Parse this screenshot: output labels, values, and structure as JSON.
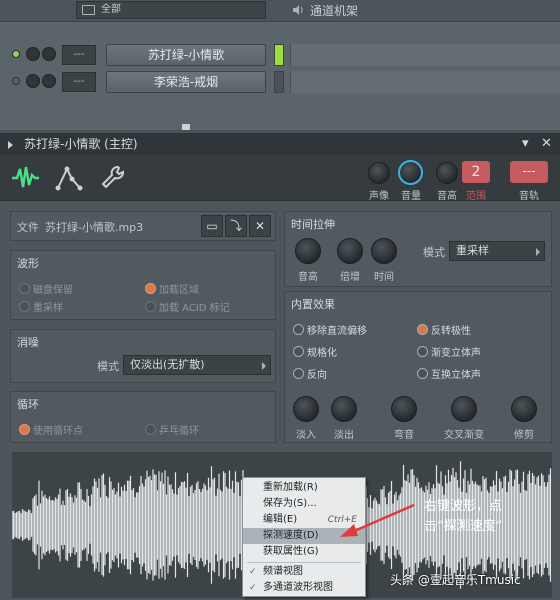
{
  "rack": {
    "filter_label": "全部",
    "title": "通道机架",
    "channels": [
      {
        "number": "---",
        "name": "苏打绿-小情歌"
      },
      {
        "number": "---",
        "name": "李荣浩-戒烟"
      }
    ]
  },
  "plugin": {
    "title": "苏打绿-小情歌 (主控)",
    "pin_label": "▾",
    "close_label": "✕",
    "knobs": {
      "pan_label": "声像",
      "volume_label": "音量",
      "pitch_label": "音高",
      "range_label": "范围",
      "range_value": "2",
      "mixer_label": "音轨",
      "mixer_value": "---"
    },
    "file": {
      "label": "文件",
      "value": "苏打绿-小情歌.mp3",
      "close_label": "✕"
    },
    "waveform": {
      "title": "波形",
      "opt_disk": "磁盘保留",
      "opt_load_region": "加载区域",
      "opt_resample": "重采样",
      "opt_acid": "加载 ACID 标记"
    },
    "declick": {
      "title": "消噪",
      "mode_label": "模式",
      "mode_value": "仅淡出(无扩散)"
    },
    "loop": {
      "title": "循环",
      "opt_use_loop": "使用循环点",
      "opt_pingpong": "乒乓循环"
    },
    "time_stretch": {
      "title": "时间拉伸",
      "pitch_label": "音高",
      "mul_label": "倍增",
      "time_label": "时间",
      "mode_label": "模式",
      "mode_value": "重采样"
    },
    "precomputed": {
      "title": "内置效果",
      "opt_remove_dc": "移除直流偏移",
      "opt_reverse_polarity": "反转极性",
      "opt_normalize": "规格化",
      "opt_fade_stereo": "渐变立体声",
      "opt_reverse": "反向",
      "opt_swap_stereo": "互换立体声",
      "fade_in": "淡入",
      "fade_out": "淡出",
      "trim": "弯音",
      "crossfade": "交叉渐变",
      "cut": "修剪"
    }
  },
  "context_menu": {
    "items": [
      {
        "label": "重新加载(R)",
        "shortcut": ""
      },
      {
        "label": "保存为(S)...",
        "shortcut": ""
      },
      {
        "label": "编辑(E)",
        "shortcut": "Ctrl+E"
      },
      {
        "label": "探测速度(D)",
        "shortcut": ""
      },
      {
        "label": "获取属性(G)",
        "shortcut": ""
      },
      {
        "label": "频谱视图",
        "shortcut": ""
      },
      {
        "label": "多通道波形视图",
        "shortcut": ""
      }
    ],
    "check_mark": "✓"
  },
  "annotation": {
    "line1": "右键波形，点",
    "line2": "击“探测速度”"
  },
  "watermark": "头条 @壹起音乐Tmusic",
  "colors": {
    "accent_green": "#4ee08a",
    "accent_orange": "#d9784a",
    "accent_red": "#c55a5f",
    "arrow_red": "#e23b3b",
    "knob_ring": "#3ab4e8"
  }
}
